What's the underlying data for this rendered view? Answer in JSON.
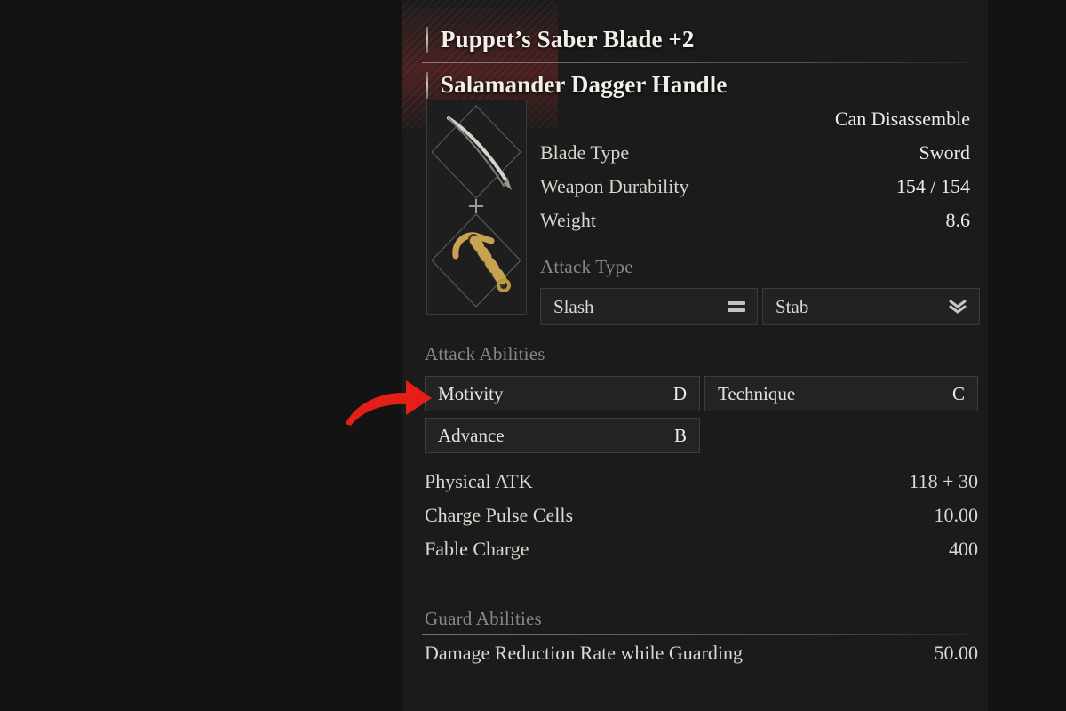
{
  "panel": {
    "weapon_title": "Puppet’s Saber Blade +2",
    "handle_title": "Salamander Dagger Handle",
    "disassemble_status": "Can Disassemble",
    "icons": {
      "blade_icon": "curved-saber-blade-icon",
      "combine_icon": "plus-icon",
      "handle_icon": "dagger-handle-icon"
    },
    "stats": [
      {
        "label": "Blade Type",
        "value": "Sword"
      },
      {
        "label": "Weapon Durability",
        "value": "154 / 154"
      },
      {
        "label": "Weight",
        "value": "8.6"
      }
    ],
    "attack_type": {
      "label": "Attack Type",
      "options": [
        {
          "name": "Slash",
          "icon": "equals-icon"
        },
        {
          "name": "Stab",
          "icon": "double-chevron-down-icon"
        }
      ]
    },
    "attack_abilities": {
      "label": "Attack Abilities",
      "items": [
        {
          "name": "Motivity",
          "grade": "D"
        },
        {
          "name": "Technique",
          "grade": "C"
        },
        {
          "name": "Advance",
          "grade": "B"
        }
      ]
    },
    "attack_stats": [
      {
        "label": "Physical ATK",
        "value": "118 + 30"
      },
      {
        "label": "Charge Pulse Cells",
        "value": "10.00"
      },
      {
        "label": "Fable Charge",
        "value": "400"
      }
    ],
    "guard_abilities": {
      "label": "Guard Abilities",
      "items": [
        {
          "label": "Damage Reduction Rate while Guarding",
          "value": "50.00"
        }
      ]
    }
  },
  "annotation": {
    "arrow_icon": "red-curved-arrow-icon",
    "arrow_color": "#e51f17",
    "points_at": "Motivity"
  },
  "colors": {
    "background": "#131313",
    "panel": "#1b1b1b",
    "text_primary": "#efebe4",
    "text_muted": "#8a8884",
    "accent_red": "#7e2424"
  }
}
